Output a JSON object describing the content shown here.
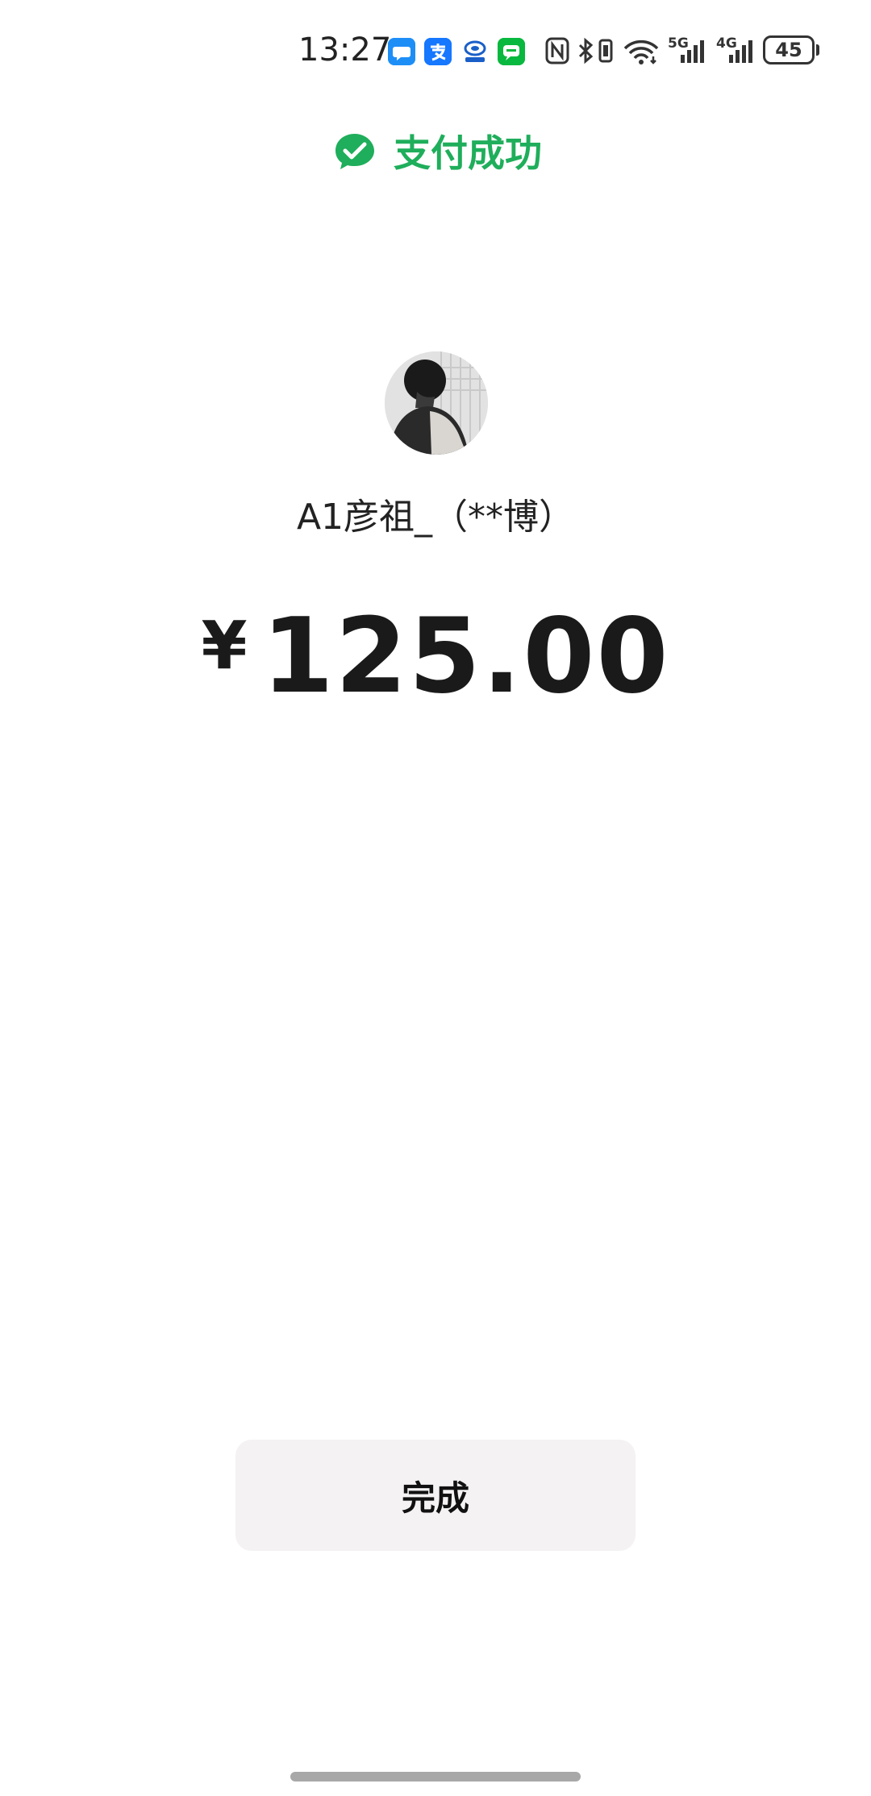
{
  "status_bar": {
    "time": "13:27",
    "notification_icons": [
      "chat-bubble-icon",
      "alipay-icon",
      "bank-icon",
      "wechat-message-icon"
    ],
    "system_icons": [
      "nfc-icon",
      "bluetooth-icon",
      "vibrate-icon",
      "wifi-icon",
      "signal-5g-icon",
      "signal-4g-icon"
    ],
    "network_1": "5G",
    "network_2": "4G",
    "battery_level": "45"
  },
  "header": {
    "title": "支付成功",
    "accent_color": "#1fae5b"
  },
  "payee": {
    "name": "A1彦祖_（**博）"
  },
  "payment": {
    "currency_symbol": "¥",
    "amount": "125.00"
  },
  "actions": {
    "done_label": "完成"
  }
}
